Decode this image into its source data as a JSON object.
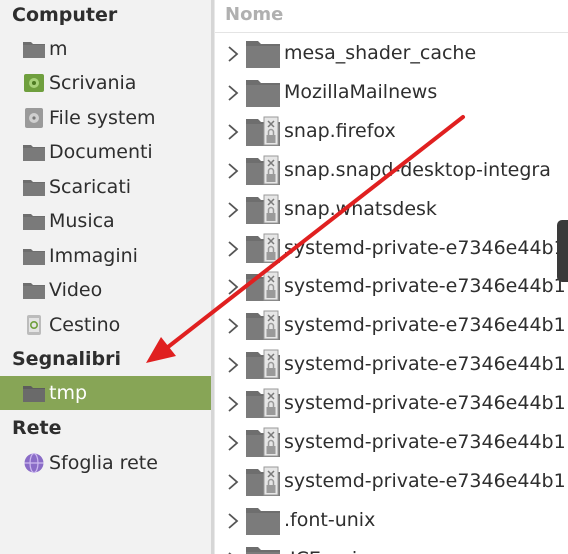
{
  "sidebar": {
    "sections": [
      {
        "heading": "Computer",
        "items": [
          {
            "label": "m",
            "icon": "folder-icon"
          },
          {
            "label": "Scrivania",
            "icon": "desktop-icon"
          },
          {
            "label": "File system",
            "icon": "drive-icon"
          },
          {
            "label": "Documenti",
            "icon": "folder-icon"
          },
          {
            "label": "Scaricati",
            "icon": "folder-icon"
          },
          {
            "label": "Musica",
            "icon": "folder-icon"
          },
          {
            "label": "Immagini",
            "icon": "folder-icon"
          },
          {
            "label": "Video",
            "icon": "folder-icon"
          },
          {
            "label": "Cestino",
            "icon": "trash-icon"
          }
        ]
      },
      {
        "heading": "Segnalibri",
        "items": [
          {
            "label": "tmp",
            "icon": "folder-icon",
            "selected": true
          }
        ]
      },
      {
        "heading": "Rete",
        "items": [
          {
            "label": "Sfoglia rete",
            "icon": "network-icon"
          }
        ]
      }
    ]
  },
  "list": {
    "column_header": "Nome",
    "rows": [
      {
        "name": "mesa_shader_cache",
        "icon": "folder-icon"
      },
      {
        "name": "MozillaMailnews",
        "icon": "folder-icon"
      },
      {
        "name": "snap.firefox",
        "icon": "locked-folder-icon"
      },
      {
        "name": "snap.snapd-desktop-integra",
        "icon": "locked-folder-icon"
      },
      {
        "name": "snap.whatsdesk",
        "icon": "locked-folder-icon"
      },
      {
        "name": "systemd-private-e7346e44b1",
        "icon": "locked-folder-icon"
      },
      {
        "name": "systemd-private-e7346e44b1",
        "icon": "locked-folder-icon"
      },
      {
        "name": "systemd-private-e7346e44b1",
        "icon": "locked-folder-icon"
      },
      {
        "name": "systemd-private-e7346e44b1",
        "icon": "locked-folder-icon"
      },
      {
        "name": "systemd-private-e7346e44b1",
        "icon": "locked-folder-icon"
      },
      {
        "name": "systemd-private-e7346e44b1",
        "icon": "locked-folder-icon"
      },
      {
        "name": "systemd-private-e7346e44b1",
        "icon": "locked-folder-icon"
      },
      {
        "name": ".font-unix",
        "icon": "folder-icon"
      },
      {
        "name": ".ICE-unix",
        "icon": "folder-icon"
      }
    ]
  },
  "colors": {
    "accent": "#87a556",
    "folder": "#6e6e6e",
    "arrow": "#e02020"
  }
}
